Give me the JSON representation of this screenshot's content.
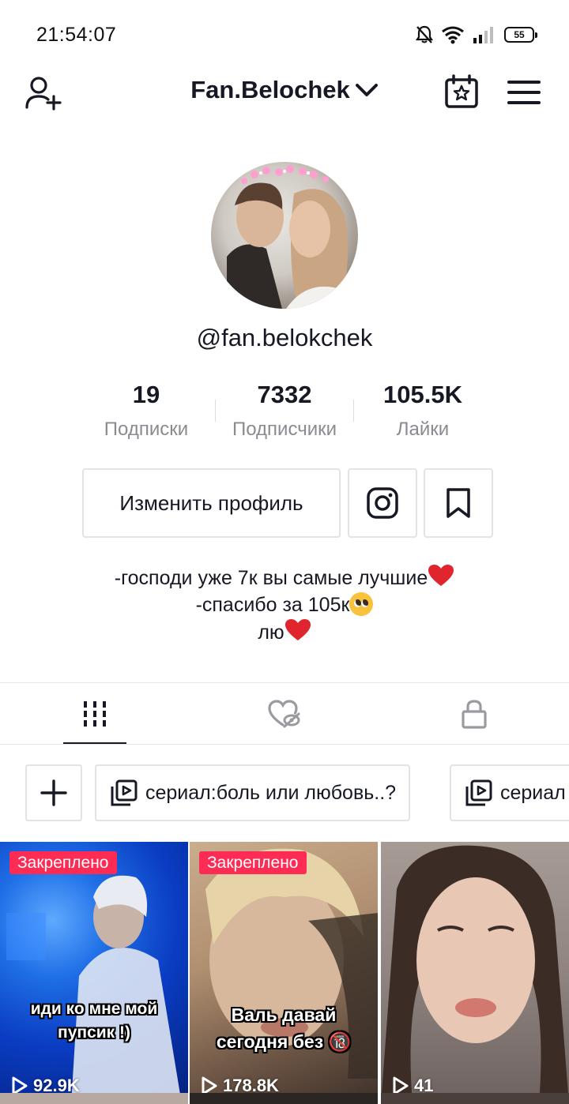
{
  "status_bar": {
    "time": "21:54:07",
    "battery": "55",
    "icons": [
      "bell-muted-icon",
      "wifi-icon",
      "signal-icon",
      "battery-icon"
    ]
  },
  "header": {
    "account_name": "Fan.Belochek",
    "icons": [
      "add-user-icon",
      "chevron-down-icon",
      "calendar-star-icon",
      "hamburger-menu-icon"
    ]
  },
  "profile": {
    "username": "@fan.belokchek",
    "stats": [
      {
        "value": "19",
        "label": "Подписки"
      },
      {
        "value": "7332",
        "label": "Подписчики"
      },
      {
        "value": "105.5K",
        "label": "Лайки"
      }
    ],
    "edit_button": "Изменить профиль",
    "bio": [
      "-господи уже 7к вы самые лучшие",
      "-спасибо за 105к",
      "лю"
    ]
  },
  "tabs": [
    "videos-grid-icon",
    "liked-hidden-icon",
    "private-lock-icon"
  ],
  "playlists": [
    {
      "label": "сериал:боль или любовь..?"
    },
    {
      "label": "сериал"
    }
  ],
  "videos": [
    {
      "pinned": "Закреплено",
      "caption_1": "иди ко мне мой",
      "caption_2": "пупсик !)",
      "views": "92.9K"
    },
    {
      "pinned": "Закреплено",
      "caption_1": "Валь давай",
      "caption_2": "сегодня без 🔞",
      "views": "178.8K"
    },
    {
      "pinned": "",
      "caption_1": "",
      "caption_2": "",
      "views": "41"
    }
  ],
  "colors": {
    "accent": "#fe2c55",
    "text_primary": "#161823",
    "text_secondary": "#8a8b91",
    "border": "#e3e3e4"
  }
}
